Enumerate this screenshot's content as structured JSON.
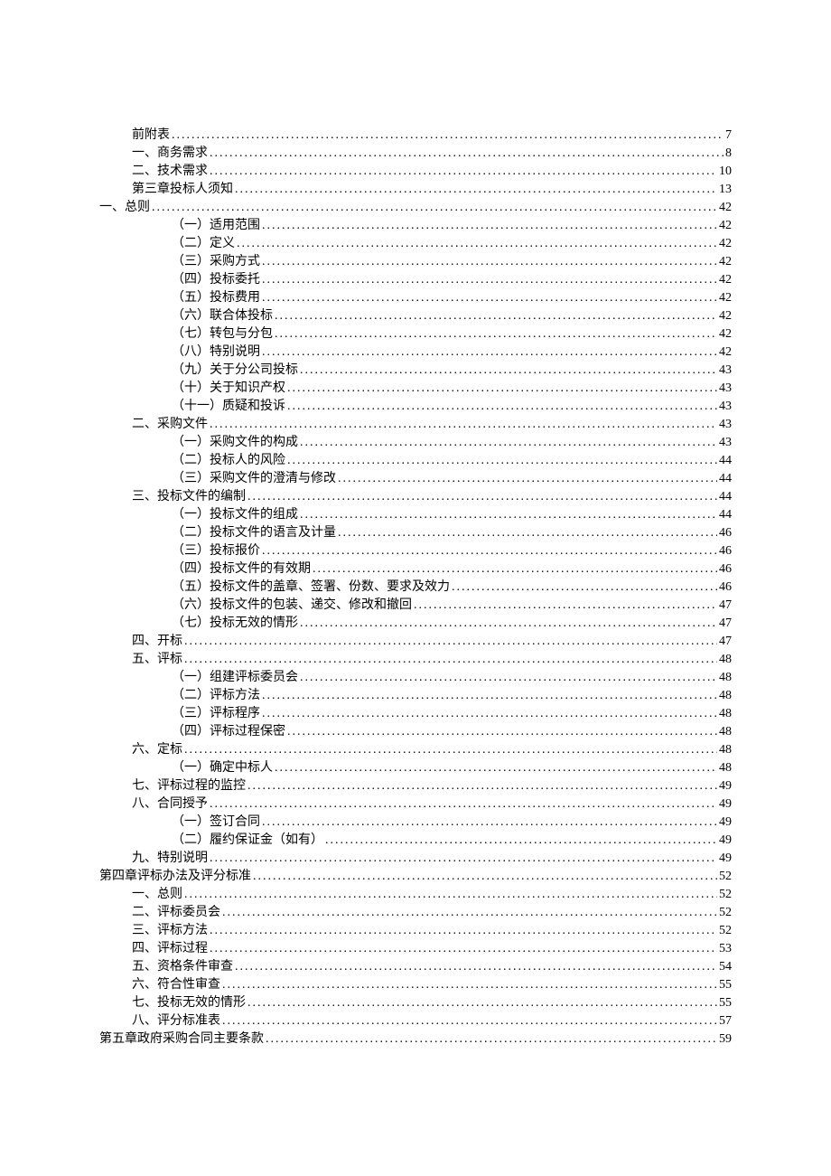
{
  "toc": [
    {
      "label": "前附表",
      "page": "7",
      "indent": 1
    },
    {
      "label": "一、商务需求",
      "page": "8",
      "indent": 1
    },
    {
      "label": "二、技术需求",
      "page": "10",
      "indent": 1
    },
    {
      "label": "第三章投标人须知",
      "page": "13",
      "indent": 1
    },
    {
      "label": "一、总则",
      "page": "42",
      "indent": 0
    },
    {
      "label": "（一）适用范围",
      "page": "42",
      "indent": 2
    },
    {
      "label": "（二）定义",
      "page": "42",
      "indent": 2
    },
    {
      "label": "（三）采购方式",
      "page": "42",
      "indent": 2
    },
    {
      "label": "（四）投标委托",
      "page": "42",
      "indent": 2
    },
    {
      "label": "（五）投标费用",
      "page": "42",
      "indent": 2
    },
    {
      "label": "（六）联合体投标",
      "page": "42",
      "indent": 2
    },
    {
      "label": "（七）转包与分包",
      "page": "42",
      "indent": 2
    },
    {
      "label": "（八）特别说明",
      "page": "42",
      "indent": 2
    },
    {
      "label": "（九）关于分公司投标",
      "page": "43",
      "indent": 2
    },
    {
      "label": "（十）关于知识产权",
      "page": "43",
      "indent": 2
    },
    {
      "label": "（十一）质疑和投诉",
      "page": "43",
      "indent": 2
    },
    {
      "label": "二、采购文件",
      "page": "43",
      "indent": 1
    },
    {
      "label": "（一）采购文件的构成",
      "page": "43",
      "indent": 2
    },
    {
      "label": "（二）投标人的风险",
      "page": "44",
      "indent": 2
    },
    {
      "label": "（三）采购文件的澄清与修改",
      "page": "44",
      "indent": 2
    },
    {
      "label": "三、投标文件的编制",
      "page": "44",
      "indent": 1
    },
    {
      "label": "（一）投标文件的组成",
      "page": "44",
      "indent": 2
    },
    {
      "label": "（二）投标文件的语言及计量",
      "page": "46",
      "indent": 2
    },
    {
      "label": "（三）投标报价",
      "page": "46",
      "indent": 2
    },
    {
      "label": "（四）投标文件的有效期",
      "page": "46",
      "indent": 2
    },
    {
      "label": "（五）投标文件的盖章、签署、份数、要求及效力",
      "page": "46",
      "indent": 2
    },
    {
      "label": "（六）投标文件的包装、递交、修改和撤回",
      "page": "47",
      "indent": 2
    },
    {
      "label": "（七）投标无效的情形",
      "page": "47",
      "indent": 2
    },
    {
      "label": "四、开标",
      "page": "47",
      "indent": 1
    },
    {
      "label": "五、评标",
      "page": "48",
      "indent": 1
    },
    {
      "label": "（一）组建评标委员会",
      "page": "48",
      "indent": 2
    },
    {
      "label": "（二）评标方法",
      "page": "48",
      "indent": 2
    },
    {
      "label": "（三）评标程序",
      "page": "48",
      "indent": 2
    },
    {
      "label": "（四）评标过程保密",
      "page": "48",
      "indent": 2
    },
    {
      "label": "六、定标",
      "page": "48",
      "indent": 1
    },
    {
      "label": "（一）确定中标人",
      "page": "48",
      "indent": 2
    },
    {
      "label": "七、评标过程的监控",
      "page": "49",
      "indent": 1
    },
    {
      "label": "八、合同授予",
      "page": "49",
      "indent": 1
    },
    {
      "label": "（一）签订合同",
      "page": "49",
      "indent": 2
    },
    {
      "label": "（二）履约保证金（如有）",
      "page": "49",
      "indent": 2
    },
    {
      "label": "九、特别说明",
      "page": "49",
      "indent": 1
    },
    {
      "label": "第四章评标办法及评分标准",
      "page": "52",
      "indent": 0
    },
    {
      "label": "一、总则",
      "page": "52",
      "indent": 1
    },
    {
      "label": "二、评标委员会",
      "page": "52",
      "indent": 1
    },
    {
      "label": "三、评标方法",
      "page": "52",
      "indent": 1
    },
    {
      "label": "四、评标过程",
      "page": "53",
      "indent": 1
    },
    {
      "label": "五、资格条件审查",
      "page": "54",
      "indent": 1
    },
    {
      "label": "六、符合性审查",
      "page": "55",
      "indent": 1
    },
    {
      "label": "七、投标无效的情形",
      "page": "55",
      "indent": 1
    },
    {
      "label": "八、评分标准表",
      "page": "57",
      "indent": 1
    },
    {
      "label": "第五章政府采购合同主要条款",
      "page": "59",
      "indent": 0
    }
  ]
}
